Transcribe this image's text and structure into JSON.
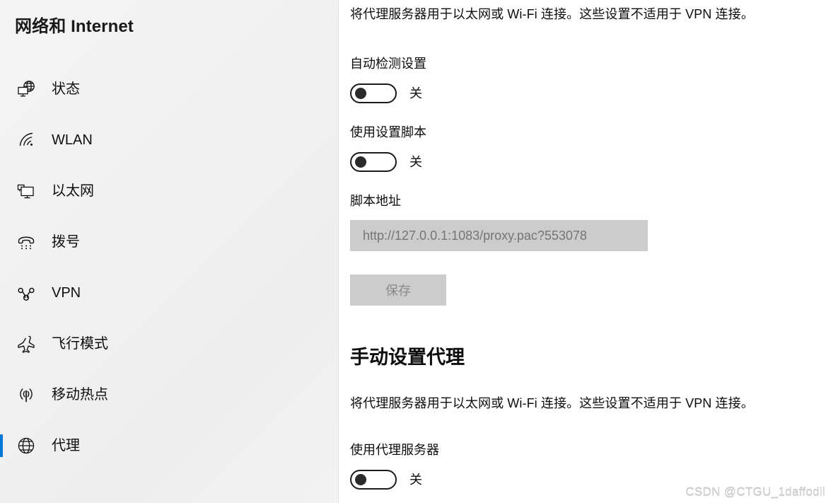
{
  "sidebar": {
    "title": "网络和 Internet",
    "selected_index": 7,
    "accent_color": "#0078d7",
    "items": [
      {
        "label": "状态",
        "icon": "status-globe-monitor-icon"
      },
      {
        "label": "WLAN",
        "icon": "wifi-icon"
      },
      {
        "label": "以太网",
        "icon": "ethernet-icon"
      },
      {
        "label": "拨号",
        "icon": "dialup-phone-icon"
      },
      {
        "label": "VPN",
        "icon": "vpn-key-icon"
      },
      {
        "label": "飞行模式",
        "icon": "airplane-icon"
      },
      {
        "label": "移动热点",
        "icon": "mobile-hotspot-icon"
      },
      {
        "label": "代理",
        "icon": "proxy-globe-icon"
      }
    ]
  },
  "main": {
    "auto_proxy_description": "将代理服务器用于以太网或 Wi-Fi 连接。这些设置不适用于 VPN 连接。",
    "auto_detect": {
      "label": "自动检测设置",
      "state": "关"
    },
    "use_setup_script": {
      "label": "使用设置脚本",
      "state": "关"
    },
    "script_address": {
      "label": "脚本地址",
      "value": "http://127.0.0.1:1083/proxy.pac?553078",
      "placeholder": "http://127.0.0.1:1083/proxy.pac?553078"
    },
    "save_button": {
      "label": "保存",
      "enabled": false
    },
    "manual_section": {
      "heading": "手动设置代理",
      "description": "将代理服务器用于以太网或 Wi-Fi 连接。这些设置不适用于 VPN 连接。",
      "use_proxy_server": {
        "label": "使用代理服务器",
        "state": "关"
      }
    }
  },
  "watermark": {
    "text": "CSDN @CTGU_1daffodil",
    "overlay_text": "CSDN @CTGU_1daffodil"
  }
}
